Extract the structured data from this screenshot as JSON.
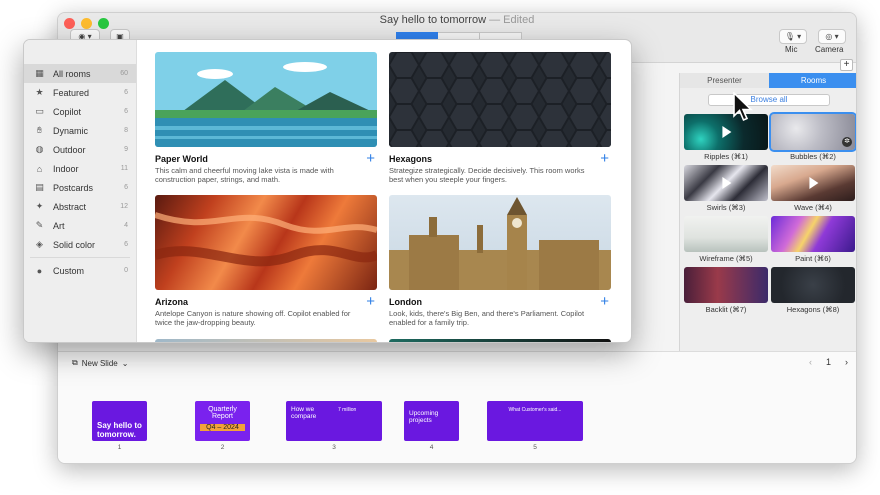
{
  "back_window": {
    "title": "Say hello to tomorrow",
    "title_suffix": " — Edited",
    "toolbar": {
      "mic_label": "Mic",
      "camera_label": "Camera",
      "add_label": "+"
    },
    "panel": {
      "tabs": [
        {
          "label": "Presenter",
          "active": false
        },
        {
          "label": "Rooms",
          "active": true
        }
      ],
      "browse_label": "Browse all",
      "rooms": [
        {
          "label": "Ripples (⌘1)",
          "icon": "play-icon"
        },
        {
          "label": "Bubbles (⌘2)",
          "icon": "play-icon",
          "selected": true
        },
        {
          "label": "Swirls (⌘3)",
          "icon": "play-icon"
        },
        {
          "label": "Wave (⌘4)",
          "icon": "play-icon"
        },
        {
          "label": "Wireframe (⌘5)"
        },
        {
          "label": "Paint (⌘6)"
        },
        {
          "label": "Backlit (⌘7)"
        },
        {
          "label": "Hexagons (⌘8)"
        }
      ]
    },
    "slide_bar": {
      "new_slide_label": "New Slide",
      "page": "1",
      "slides": [
        {
          "number": "1",
          "text": "Say hello to tomorrow."
        },
        {
          "number": "2",
          "text": "Quarterly Report",
          "sub": "Q4 – 2024"
        },
        {
          "number": "3",
          "text": "How we compare",
          "sub": "7 million"
        },
        {
          "number": "4",
          "text": "Upcoming projects"
        },
        {
          "number": "5",
          "text": "What Customer's said..."
        }
      ]
    }
  },
  "front_window": {
    "sidebar": {
      "items": [
        {
          "label": "All rooms",
          "count": "60",
          "icon": "grid-icon",
          "active": true
        },
        {
          "label": "Featured",
          "count": "6",
          "icon": "star-icon"
        },
        {
          "label": "Copilot",
          "count": "6",
          "icon": "copilot-icon"
        },
        {
          "label": "Dynamic",
          "count": "8",
          "icon": "hand-icon"
        },
        {
          "label": "Outdoor",
          "count": "9",
          "icon": "globe-icon"
        },
        {
          "label": "Indoor",
          "count": "11",
          "icon": "house-icon"
        },
        {
          "label": "Postcards",
          "count": "6",
          "icon": "postcard-icon"
        },
        {
          "label": "Abstract",
          "count": "12",
          "icon": "abstract-icon"
        },
        {
          "label": "Art",
          "count": "4",
          "icon": "brush-icon"
        },
        {
          "label": "Solid color",
          "count": "6",
          "icon": "layers-icon"
        }
      ],
      "custom": {
        "label": "Custom",
        "count": "0",
        "icon": "person-icon"
      }
    },
    "rooms": [
      {
        "title": "Paper World",
        "desc": "This calm and cheerful moving lake vista is made with construction paper, strings, and math."
      },
      {
        "title": "Hexagons",
        "desc": "Strategize strategically. Decide decisively. This room works best when you steeple your fingers."
      },
      {
        "title": "Arizona",
        "desc": "Antelope Canyon is nature showing off. Copilot enabled for twice the jaw-dropping beauty."
      },
      {
        "title": "London",
        "desc": "Look, kids, there's Big Ben, and there's Parliament. Copilot enabled for a family trip."
      }
    ]
  }
}
